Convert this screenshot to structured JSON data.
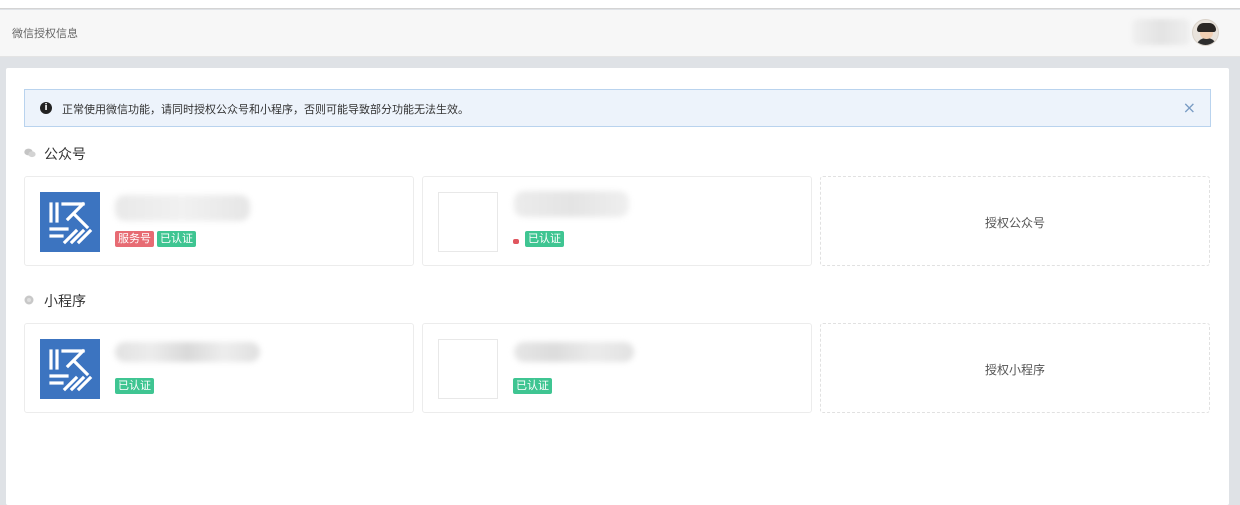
{
  "header": {
    "title": "微信授权信息"
  },
  "alert": {
    "icon": "info-icon",
    "message": "正常使用微信功能，请同时授权公众号和小程序，否则可能导致部分功能无法生效。",
    "close": "×"
  },
  "official_accounts": {
    "title": "公众号",
    "icon": "wechat-icon",
    "cards": [
      {
        "badges": [
          "服务号",
          "已认证"
        ]
      },
      {
        "badges": [
          "已认证"
        ]
      }
    ],
    "authorize_label": "授权公众号"
  },
  "mini_programs": {
    "title": "小程序",
    "icon": "dot-icon",
    "cards": [
      {
        "badges": [
          "已认证"
        ]
      },
      {
        "badges": [
          "已认证"
        ]
      }
    ],
    "authorize_label": "授权小程序"
  },
  "colors": {
    "brand_logo": "#3c74c0",
    "badge_green": "#3fc592",
    "badge_red": "#e76b73",
    "alert_bg": "#edf3fb"
  }
}
